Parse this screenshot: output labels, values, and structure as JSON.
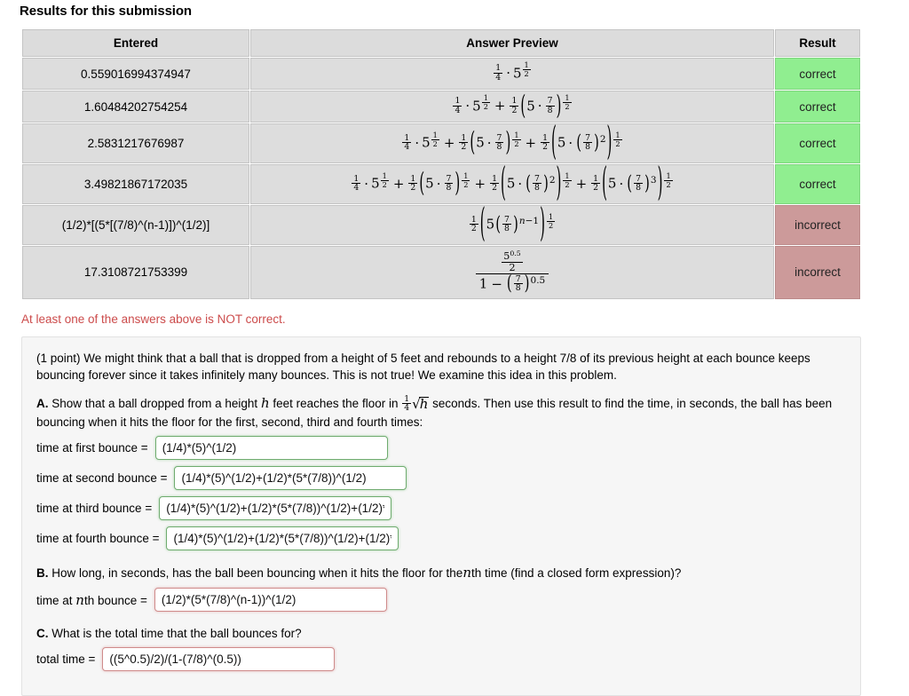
{
  "heading": "Results for this submission",
  "table": {
    "headers": [
      "Entered",
      "Answer Preview",
      "Result"
    ],
    "rows": [
      {
        "entered": "0.559016994374947",
        "result": "correct",
        "preview_text": "(1/4)*5^(1/2)"
      },
      {
        "entered": "1.60484202754254",
        "result": "correct",
        "preview_text": "(1/4)*5^(1/2) + (1/2)(5*(7/8))^(1/2)"
      },
      {
        "entered": "2.5831217676987",
        "result": "correct",
        "preview_text": "(1/4)*5^(1/2) + (1/2)(5*(7/8))^(1/2) + (1/2)(5*((7/8))^2)^(1/2)"
      },
      {
        "entered": "3.49821867172035",
        "result": "correct",
        "preview_text": "(1/4)*5^(1/2) + (1/2)(5*(7/8))^(1/2) + (1/2)(5*((7/8))^2)^(1/2) + (1/2)(5*((7/8))^3)^(1/2)"
      },
      {
        "entered": "(1/2)*[(5*[(7/8)^(n-1)])^(1/2)]",
        "result": "incorrect",
        "preview_text": "(1/2)(5(7/8)^(n-1))^(1/2)"
      },
      {
        "entered": "17.3108721753399",
        "result": "incorrect",
        "preview_text": "(5^0.5/2)/(1-(7/8)^0.5)"
      }
    ]
  },
  "error_note": "At least one of the answers above is NOT correct.",
  "problem": {
    "intro": "(1 point) We might think that a ball that is dropped from a height of 5 feet and rebounds to a height 7/8 of its previous height at each bounce keeps bouncing forever since it takes infinitely many bounces. This is not true! We examine this idea in this problem.",
    "part_a_label": "A.",
    "part_a_text_1": "Show that a ball dropped from a height",
    "part_a_var": "h",
    "part_a_text_2": "feet reaches the floor in",
    "part_a_frac_num": "1",
    "part_a_frac_den": "4",
    "part_a_sqrt_var": "h",
    "part_a_text_3": "seconds. Then use this result to find the time, in seconds, the ball has been bouncing when it hits the floor for the first, second, third and fourth times:",
    "fields_a": [
      {
        "label": "time at first bounce =",
        "value": "(1/4)*(5)^(1/2)",
        "state": "ok"
      },
      {
        "label": "time at second bounce =",
        "value": "(1/4)*(5)^(1/2)+(1/2)*(5*(7/8))^(1/2)",
        "state": "ok"
      },
      {
        "label": "time at third bounce =",
        "value": "(1/4)*(5)^(1/2)+(1/2)*(5*(7/8))^(1/2)+(1/2)*(",
        "state": "ok"
      },
      {
        "label": "time at fourth bounce =",
        "value": "(1/4)*(5)^(1/2)+(1/2)*(5*(7/8))^(1/2)+(1/2)*(",
        "state": "ok"
      }
    ],
    "part_b_label": "B.",
    "part_b_text_1": "How long, in seconds, has the ball been bouncing when it hits the floor for the",
    "part_b_var": "n",
    "part_b_text_2": "th time (find a closed form expression)?",
    "field_b": {
      "label_pre": "time at",
      "label_var": "n",
      "label_post": "th bounce =",
      "value": "(1/2)*(5*(7/8)^(n-1))^(1/2)",
      "state": "bad"
    },
    "part_c_label": "C.",
    "part_c_text": "What is the total time that the ball bounces for?",
    "field_c": {
      "label": "total time =",
      "value": "((5^0.5)/2)/(1-(7/8)^(0.5))",
      "state": "bad"
    }
  },
  "colors": {
    "correct_bg": "#90ee90",
    "incorrect_bg": "#cc9a9a",
    "error_text": "#cc4b4b",
    "cell_bg": "#dddddd",
    "panel_bg": "#f6f6f6"
  }
}
